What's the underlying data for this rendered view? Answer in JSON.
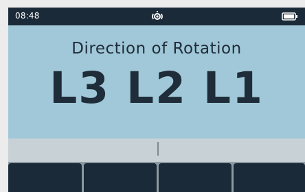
{
  "status_bar": {
    "time": "08:48",
    "center_icon": "rotation-indicator-icon",
    "battery_icon": "battery-icon"
  },
  "main": {
    "title": "Direction of Rotation",
    "phase_sequence": "L3 L2 L1"
  },
  "softkeys": {
    "count": 4,
    "labels": [
      "",
      "",
      "",
      ""
    ]
  },
  "colors": {
    "display_background": "#a1c8d8",
    "text": "#1f2c39",
    "bezel": "#1b2a38",
    "softkey_label_bar": "#c7d1d6"
  }
}
